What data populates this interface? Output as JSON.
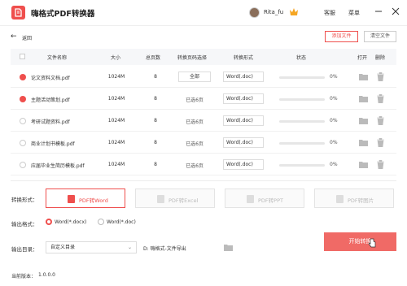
{
  "app": {
    "title": "嗨格式PDF转换器"
  },
  "user": {
    "name": "Rita_fu"
  },
  "header": {
    "service": "客服",
    "menu": "菜单"
  },
  "toolbar": {
    "back": "返回",
    "add_file": "添加文件",
    "clear_file": "清空文件"
  },
  "table": {
    "headers": {
      "name": "文件名称",
      "size": "大小",
      "pages": "总页数",
      "range": "转换页码选择",
      "format": "转换形式",
      "status": "状态",
      "open": "打开",
      "delete": "删除"
    },
    "rows": [
      {
        "name": "论文资料文档.pdf",
        "size": "1024M",
        "pages": "8",
        "range": "全部",
        "format": "Word(.doc)",
        "progress": "0%",
        "checked": true
      },
      {
        "name": "主题活动策划.pdf",
        "size": "1024M",
        "pages": "8",
        "range": "已选6页",
        "format": "Word(.doc)",
        "progress": "0%",
        "checked": true
      },
      {
        "name": "考研试题资料.pdf",
        "size": "1024M",
        "pages": "8",
        "range": "已选6页",
        "format": "Word(.doc)",
        "progress": "0%",
        "checked": false
      },
      {
        "name": "商业计划书模板.pdf",
        "size": "1024M",
        "pages": "8",
        "range": "已选6页",
        "format": "Word(.doc)",
        "progress": "0%",
        "checked": false
      },
      {
        "name": "应届毕业生简历模板.pdf",
        "size": "1024M",
        "pages": "8",
        "range": "已选6页",
        "format": "Word(.doc)",
        "progress": "0%",
        "checked": false
      }
    ]
  },
  "convert": {
    "label": "转换形式：",
    "options": [
      "PDF转Word",
      "PDF转Excel",
      "PDF转PPT",
      "PDF转图片"
    ],
    "selected": "PDF转Word"
  },
  "output_format": {
    "label": "输出格式：",
    "options": [
      "Word(*.docx)",
      "Word(*.doc)"
    ],
    "selected": "Word(*.docx)"
  },
  "output_dir": {
    "label": "输出目录：",
    "select": "自定义目录",
    "path": "D:   嗨格式-文件导出"
  },
  "start": {
    "label": "开始转换"
  },
  "footer": {
    "version_label": "当前版本：",
    "version": "1.0.0.0"
  },
  "colors": {
    "accent": "#ef4f4d",
    "button": "#f06a66"
  }
}
